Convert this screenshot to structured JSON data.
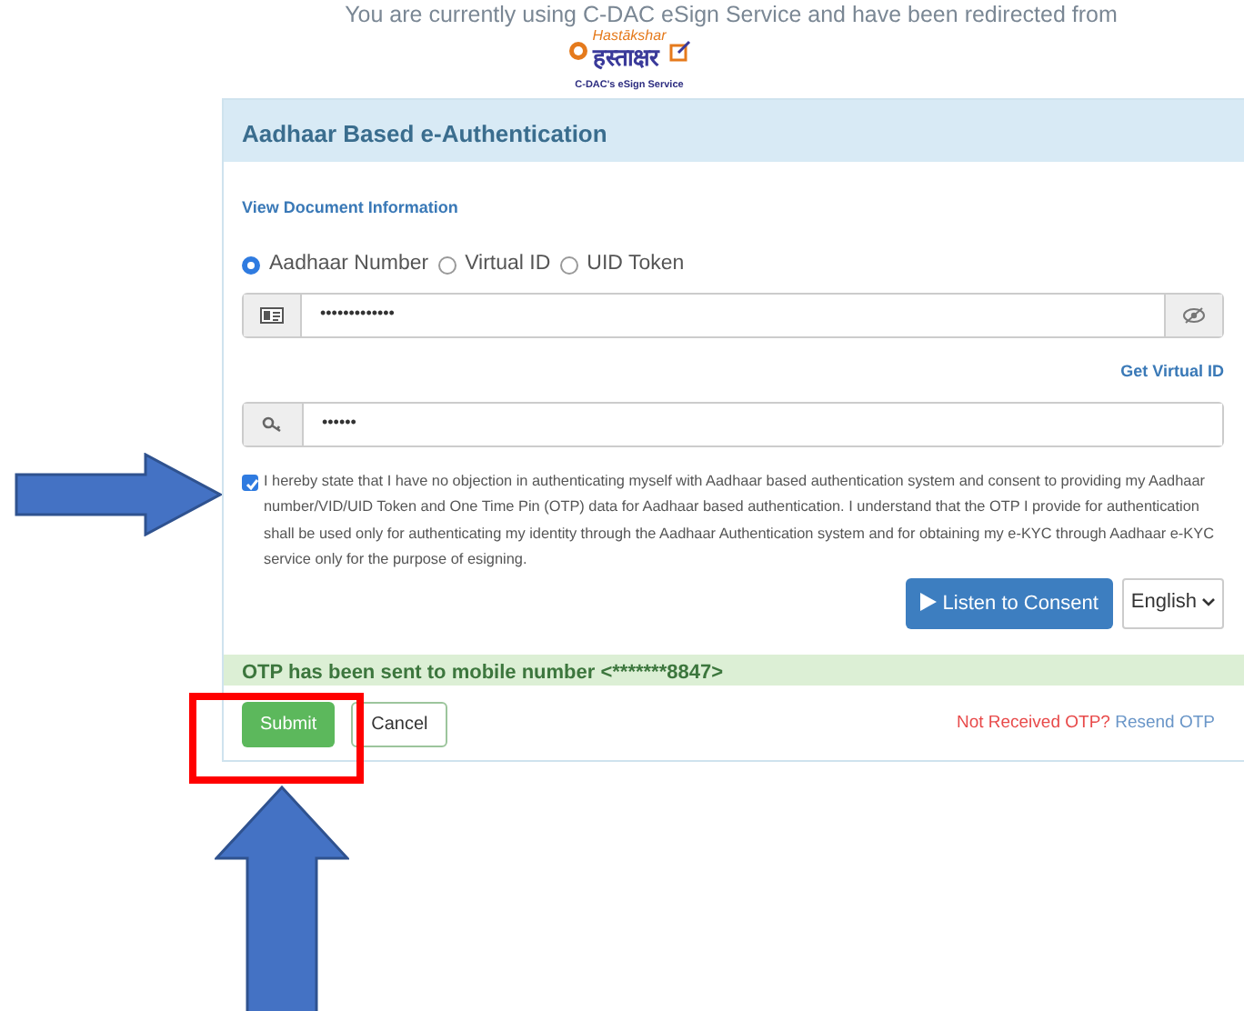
{
  "header_text": "You are currently using C-DAC eSign Service and have been redirected from",
  "logo": {
    "latin": "Hastākshar",
    "devanagari": "हस्ताक्षर",
    "caption": "C-DAC's eSign Service"
  },
  "panel": {
    "title": "Aadhaar Based e-Authentication",
    "view_document_link": "View Document Information",
    "id_types": [
      {
        "label": "Aadhaar Number",
        "selected": true
      },
      {
        "label": "Virtual ID",
        "selected": false
      },
      {
        "label": "UID Token",
        "selected": false
      }
    ],
    "id_field": {
      "value": "•••••••••••••"
    },
    "get_virtual_id_link": "Get Virtual ID",
    "otp_field": {
      "value": "••••••"
    },
    "consent": {
      "checked": true,
      "text": "I hereby state that I have no objection in authenticating myself with Aadhaar based authentication system and consent to providing my Aadhaar number/VID/UID Token and One Time Pin (OTP) data for Aadhaar based authentication. I understand that the OTP I provide for authentication shall be used only for authenticating my identity through the Aadhaar Authentication system and for obtaining my e-KYC through Aadhaar e-KYC service only for the purpose of esigning."
    },
    "listen_button": "Listen to Consent",
    "language": "English",
    "otp_message": "OTP has been sent to mobile number <*******8847>",
    "submit_button": "Submit",
    "cancel_button": "Cancel",
    "not_received": "Not Received OTP?",
    "resend_link": "Resend OTP"
  },
  "annotations": [
    {
      "kind": "arrow-right"
    },
    {
      "kind": "highlight-box"
    },
    {
      "kind": "arrow-up"
    }
  ]
}
